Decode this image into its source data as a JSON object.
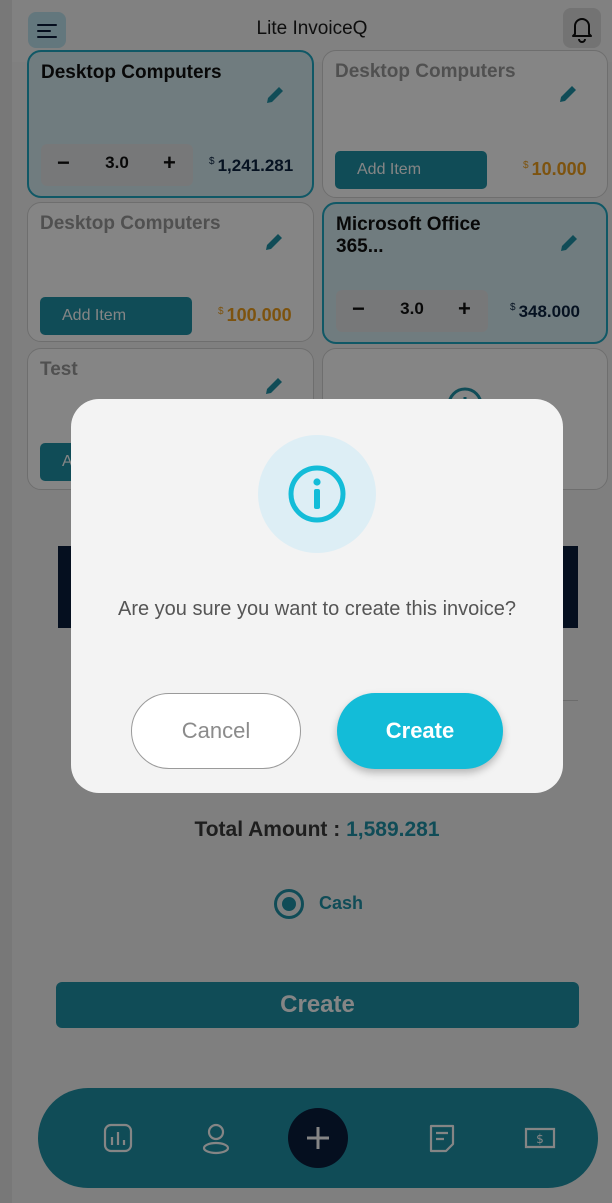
{
  "header": {
    "title": "Lite InvoiceQ",
    "menu_icon": "menu-icon",
    "bell_icon": "bell-icon"
  },
  "products": [
    {
      "name": "Desktop Computers",
      "selected": true,
      "quantity": "3.0",
      "currency": "$",
      "price": "1,241.281"
    },
    {
      "name": "Desktop Computers",
      "selected": false,
      "add_label": "Add Item",
      "currency": "$",
      "price": "10.000"
    },
    {
      "name": "Desktop Computers",
      "selected": false,
      "add_label": "Add Item",
      "currency": "$",
      "price": "100.000"
    },
    {
      "name": "Microsoft Office 365...",
      "selected": true,
      "quantity": "3.0",
      "currency": "$",
      "price": "348.000"
    },
    {
      "name": "Test",
      "selected": false,
      "add_label": "A",
      "currency": "",
      "price": ""
    }
  ],
  "stepper": {
    "minus": "−",
    "plus": "+"
  },
  "summary": {
    "total_label": "Total Amount",
    "separator": " : ",
    "total_value": "1,589.281",
    "payment_option": "Cash",
    "create_label": "Create"
  },
  "dialog": {
    "icon": "info-icon",
    "message": "Are you sure you want to create this invoice?",
    "cancel_label": "Cancel",
    "create_label": "Create"
  },
  "bottom_nav": {
    "items": [
      "chart-icon",
      "profile-icon",
      "add-icon",
      "invoice-icon",
      "money-icon"
    ]
  },
  "colors": {
    "accent": "#1f93a8",
    "dialog_button": "#13bcd8",
    "navy": "#0a1d3d",
    "price_orange": "#f0a01e"
  }
}
